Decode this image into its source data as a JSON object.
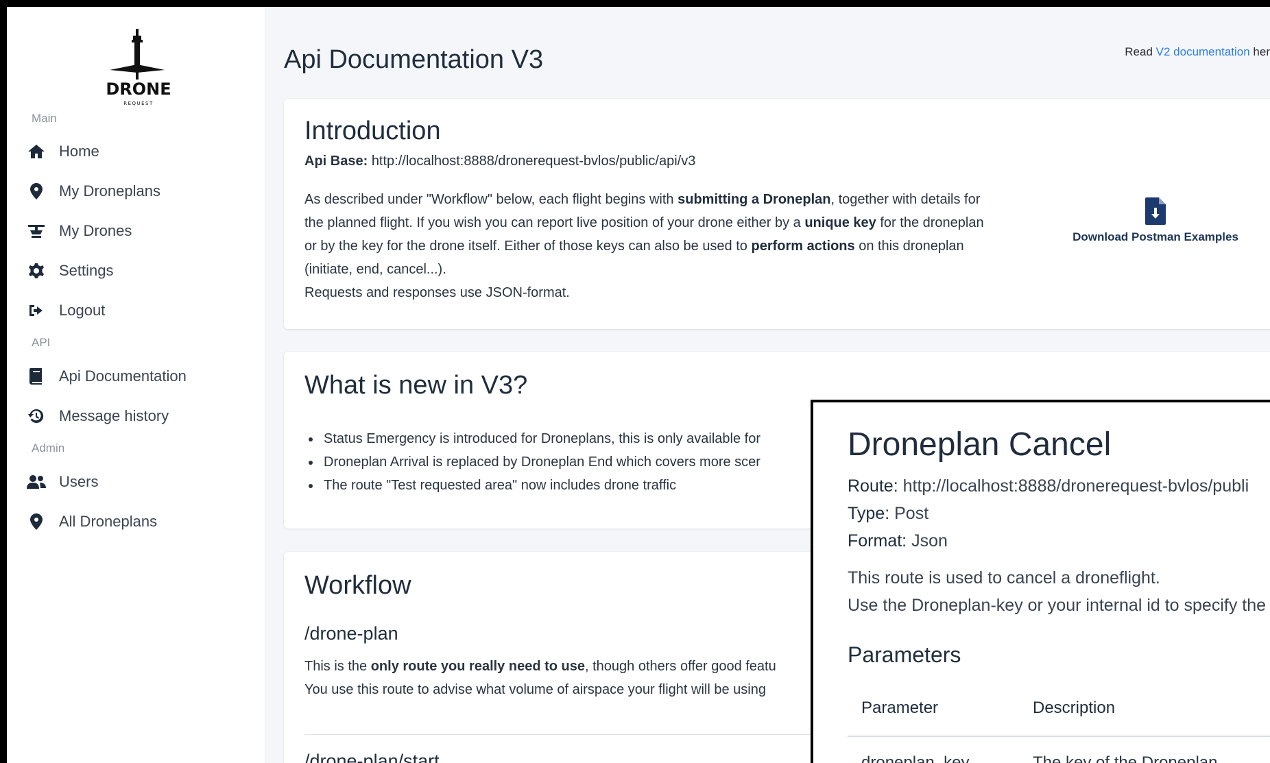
{
  "sidebar": {
    "logo_text": "DRONE",
    "logo_subtext": "REQUEST",
    "sections": {
      "main": "Main",
      "api": "API",
      "admin": "Admin"
    },
    "items": [
      {
        "label": "Home",
        "icon": "home-icon"
      },
      {
        "label": "My Droneplans",
        "icon": "map-pin-icon"
      },
      {
        "label": "My Drones",
        "icon": "drone-icon"
      },
      {
        "label": "Settings",
        "icon": "gear-icon"
      },
      {
        "label": "Logout",
        "icon": "logout-icon"
      },
      {
        "label": "Api Documentation",
        "icon": "book-icon"
      },
      {
        "label": "Message history",
        "icon": "history-icon"
      },
      {
        "label": "Users",
        "icon": "users-icon"
      },
      {
        "label": "All Droneplans",
        "icon": "map-pin-icon"
      }
    ]
  },
  "header": {
    "title": "Api Documentation V3",
    "read_prefix": "Read",
    "read_link": "V2 documentation",
    "read_suffix": "her"
  },
  "intro": {
    "title": "Introduction",
    "api_base_label": "Api Base:",
    "api_base_url": "http://localhost:8888/dronerequest-bvlos/public/api/v3",
    "p1_a": "As described under \"Workflow\" below, each flight begins with ",
    "p1_b": "submitting a Droneplan",
    "p1_c": ", together with details for the planned flight. If you wish you can report live position of your drone either by a ",
    "p1_d": "unique key",
    "p1_e": " for the droneplan or by the key for the drone itself. Either of those keys can also be used to ",
    "p1_f": "perform actions",
    "p1_g": " on this droneplan (initiate, end, cancel...).",
    "p2": "Requests and responses use JSON-format.",
    "download_label": "Download Postman Examples"
  },
  "whats_new": {
    "title": "What is new in V3?",
    "items": [
      "Status Emergency is introduced for Droneplans, this is only available for",
      "Droneplan Arrival is replaced by Droneplan End which covers more scer",
      "The route \"Test requested area\" now includes drone traffic"
    ]
  },
  "workflow": {
    "title": "Workflow",
    "sub1": "/drone-plan",
    "line1_a": "This is the ",
    "line1_b": "only route you really need to use",
    "line1_c": ", though others offer good featu",
    "line2": "You use this route to advise what volume of airspace your flight will be using",
    "sub2": "/drone-plan/start"
  },
  "overlay": {
    "title": "Droneplan Cancel",
    "route_label": "Route:",
    "route_value": "http://localhost:8888/dronerequest-bvlos/publi",
    "type_label": "Type:",
    "type_value": "Post",
    "format_label": "Format:",
    "format_value": "Json",
    "desc1": "This route is used to cancel a droneflight.",
    "desc2": "Use the Droneplan-key or your internal id to specify the",
    "params_title": "Parameters",
    "col_parameter": "Parameter",
    "col_description": "Description",
    "row1_param": "droneplan_key",
    "row1_desc": "The key of the Droneplan"
  },
  "colors": {
    "link": "#2b7de9",
    "navy": "#1d2a3a",
    "background": "#f4f6f9"
  }
}
